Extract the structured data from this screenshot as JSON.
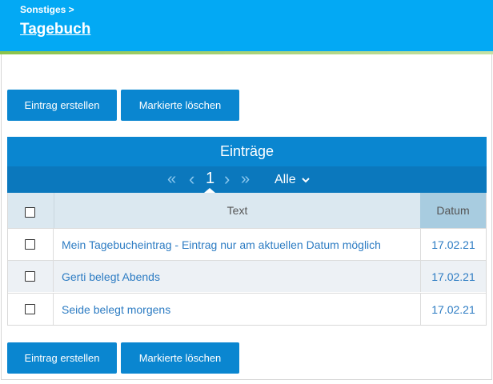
{
  "header": {
    "breadcrumb": "Sonstiges >",
    "title": "Tagebuch",
    "background": "#03a9f4",
    "accent_stripe": "#8bc34a"
  },
  "toolbar_top": {
    "create_label": "Eintrag erstellen",
    "delete_label": "Markierte löschen"
  },
  "toolbar_bottom": {
    "create_label": "Eintrag erstellen",
    "delete_label": "Markierte löschen"
  },
  "panel": {
    "title": "Einträge",
    "pager": {
      "first_icon": "«",
      "prev_icon": "‹",
      "page": "1",
      "next_icon": "›",
      "last_icon": "»",
      "filter_label": "Alle",
      "filter_icon": "chevron-down-icon"
    }
  },
  "table": {
    "columns": [
      "",
      "Text",
      "Datum"
    ],
    "rows": [
      {
        "text": "Mein Tagebucheintrag - Eintrag nur am aktuellen Datum möglich",
        "date": "17.02.21"
      },
      {
        "text": "Gerti belegt Abends",
        "date": "17.02.21"
      },
      {
        "text": "Seide belegt morgens",
        "date": "17.02.21"
      }
    ]
  }
}
